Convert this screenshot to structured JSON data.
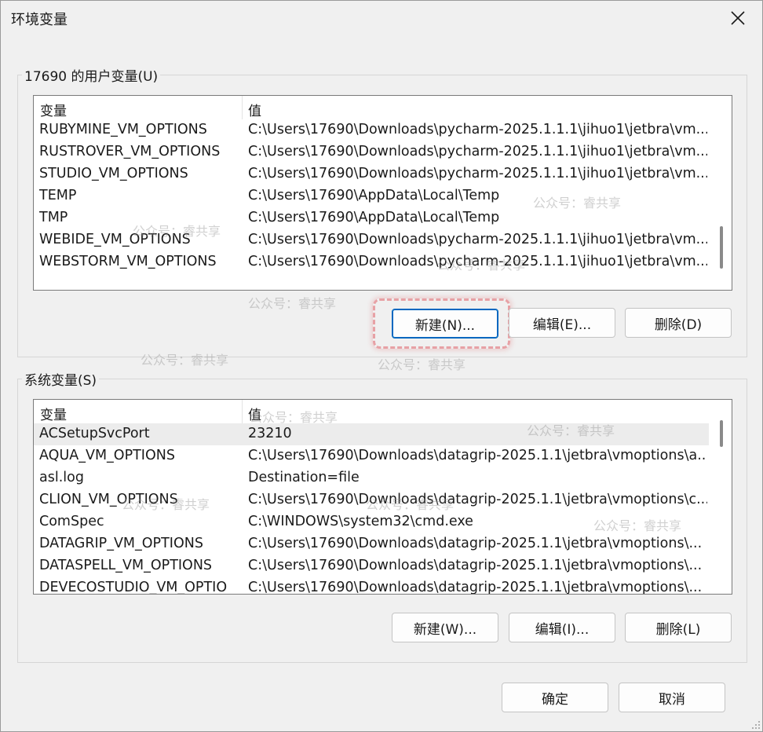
{
  "window": {
    "title": "环境变量"
  },
  "user_vars": {
    "group_label": "17690 的用户变量(U)",
    "col_name": "变量",
    "col_value": "值",
    "rows": [
      {
        "name": "RUBYMINE_VM_OPTIONS",
        "value": "C:\\Users\\17690\\Downloads\\pycharm-2025.1.1.1\\jihuo1\\jetbra\\vm..."
      },
      {
        "name": "RUSTROVER_VM_OPTIONS",
        "value": "C:\\Users\\17690\\Downloads\\pycharm-2025.1.1.1\\jihuo1\\jetbra\\vm..."
      },
      {
        "name": "STUDIO_VM_OPTIONS",
        "value": "C:\\Users\\17690\\Downloads\\pycharm-2025.1.1.1\\jihuo1\\jetbra\\vm..."
      },
      {
        "name": "TEMP",
        "value": "C:\\Users\\17690\\AppData\\Local\\Temp"
      },
      {
        "name": "TMP",
        "value": "C:\\Users\\17690\\AppData\\Local\\Temp"
      },
      {
        "name": "WEBIDE_VM_OPTIONS",
        "value": "C:\\Users\\17690\\Downloads\\pycharm-2025.1.1.1\\jihuo1\\jetbra\\vm..."
      },
      {
        "name": "WEBSTORM_VM_OPTIONS",
        "value": "C:\\Users\\17690\\Downloads\\pycharm-2025.1.1.1\\jihuo1\\jetbra\\vm..."
      }
    ],
    "buttons": {
      "new": "新建(N)...",
      "edit": "编辑(E)...",
      "delete": "删除(D)"
    }
  },
  "system_vars": {
    "group_label": "系统变量(S)",
    "col_name": "变量",
    "col_value": "值",
    "rows": [
      {
        "name": "ACSetupSvcPort",
        "value": "23210",
        "selected": true
      },
      {
        "name": "AQUA_VM_OPTIONS",
        "value": "C:\\Users\\17690\\Downloads\\datagrip-2025.1.1\\jetbra\\vmoptions\\a..."
      },
      {
        "name": "asl.log",
        "value": "Destination=file"
      },
      {
        "name": "CLION_VM_OPTIONS",
        "value": "C:\\Users\\17690\\Downloads\\datagrip-2025.1.1\\jetbra\\vmoptions\\c..."
      },
      {
        "name": "ComSpec",
        "value": "C:\\WINDOWS\\system32\\cmd.exe"
      },
      {
        "name": "DATAGRIP_VM_OPTIONS",
        "value": "C:\\Users\\17690\\Downloads\\datagrip-2025.1.1\\jetbra\\vmoptions\\..."
      },
      {
        "name": "DATASPELL_VM_OPTIONS",
        "value": "C:\\Users\\17690\\Downloads\\datagrip-2025.1.1\\jetbra\\vmoptions\\..."
      },
      {
        "name": "DEVECOSTUDIO_VM_OPTIO",
        "value": "C:\\Users\\17690\\Downloads\\datagrip-2025.1.1\\jetbra\\vmoptions\\..."
      }
    ],
    "buttons": {
      "new": "新建(W)...",
      "edit": "编辑(I)...",
      "delete": "删除(L)"
    }
  },
  "footer": {
    "ok": "确定",
    "cancel": "取消"
  },
  "watermark": "公众号：睿共享",
  "colors": {
    "focus_border": "#0067c0",
    "highlight_ring": "#e7a1a5",
    "selected_row": "#ececec"
  }
}
